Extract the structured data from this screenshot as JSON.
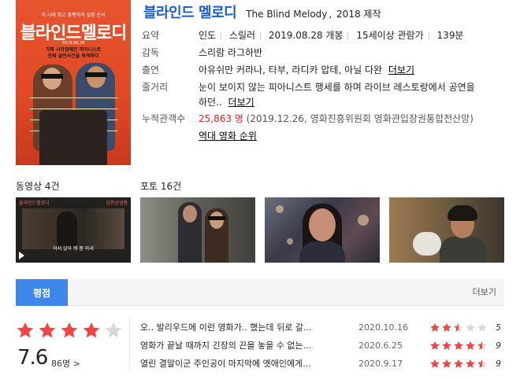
{
  "movie": {
    "title_ko": "블라인드 멜로디",
    "title_en": "The Blind Melody",
    "title_sep": ",",
    "year_label": "2018 제작"
  },
  "poster": {
    "badges": [
      "",
      ""
    ],
    "tagline": "이 시대 최고 흥행작의 일정 순서",
    "title": "블라인드멜로디",
    "date": "2019.08.28",
    "subtitle_lines": [
      "가짜 시각장애인 피아니스트",
      "진짜 살인사건을 목격하다"
    ]
  },
  "info": {
    "rows": [
      {
        "label": "요약",
        "parts": [
          "인도",
          "스릴러",
          "2019.08.28 개봉",
          "15세이상 관람가",
          "139분"
        ]
      },
      {
        "label": "감독",
        "value": "스리람 라그하반"
      },
      {
        "label": "출연",
        "value": "아유쉬만 커라나, 타부, 라디카 압테, 아닐 다완",
        "link": "더보기"
      },
      {
        "label": "줄거리",
        "value_line1": "눈이 보이지 않는 피아니스트 행세를 하며 라이브 레스토랑에서 공연을",
        "value_line2": "하던..",
        "link": "더보기"
      },
      {
        "label": "누적관객수",
        "count": "25,863 명",
        "source": "(2019.12.26, 영화진흥위원회 영화관입장권통합전산망)",
        "link": "역대 영화 순위"
      }
    ]
  },
  "media": {
    "video_label": "동영상 4건",
    "photo_label": "포토 16건",
    "video_thumb": {
      "left_caption": "블라인드멜로디",
      "right_caption": "심판상영중",
      "subtitle": "어서 앉아 뭐 좀 마셔",
      "play_icon": "play-icon"
    }
  },
  "rating": {
    "tab_label": "평점",
    "more_label": "더보기",
    "score": "7.6",
    "votes": "86명 >",
    "score_fraction": 0.76,
    "star_color": "#f04545",
    "star_off_color": "#d9d9d9",
    "reviews": [
      {
        "text": "오.. 발리우드에 이런 영화가.. 했는데 뒤로 갈...",
        "date": "2020.10.16",
        "score": "5",
        "fraction": 0.5
      },
      {
        "text": "영화가 끝날 때까지 긴장의 끈을 놓을 수 없는...",
        "date": "2020.6.25",
        "score": "9",
        "fraction": 0.9
      },
      {
        "text": "열린 결말이군 주인공이 마지막에 옛애인에게...",
        "date": "2020.9.17",
        "score": "9",
        "fraction": 0.9
      }
    ]
  }
}
